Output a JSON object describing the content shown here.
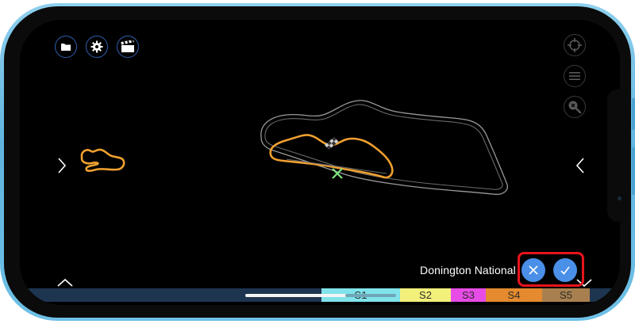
{
  "colors": {
    "accent": "#4a8fe8",
    "track_selected": "#f0a030",
    "track_outline": "#9a9a9a",
    "start_marker": "#7fe37f",
    "highlight": "#e8141c",
    "phone_frame": "#6ec0e6"
  },
  "toolbar": {
    "folder_icon": "folder-icon",
    "settings_icon": "gear-icon",
    "clapper_icon": "clapperboard-icon"
  },
  "tools": {
    "locate_icon": "crosshair-icon",
    "menu_icon": "menu-icon",
    "zoom_icon": "zoom-out-icon"
  },
  "track": {
    "name": "Donington National"
  },
  "actions": {
    "cancel_icon": "close-icon",
    "confirm_icon": "checkmark-icon"
  },
  "sectors": [
    {
      "label": "S1",
      "color": "#80e3ea"
    },
    {
      "label": "S2",
      "color": "#f2f07a"
    },
    {
      "label": "S3",
      "color": "#e84ce6"
    },
    {
      "label": "S4",
      "color": "#e58a2e"
    },
    {
      "label": "S5",
      "color": "#a8804f"
    }
  ]
}
